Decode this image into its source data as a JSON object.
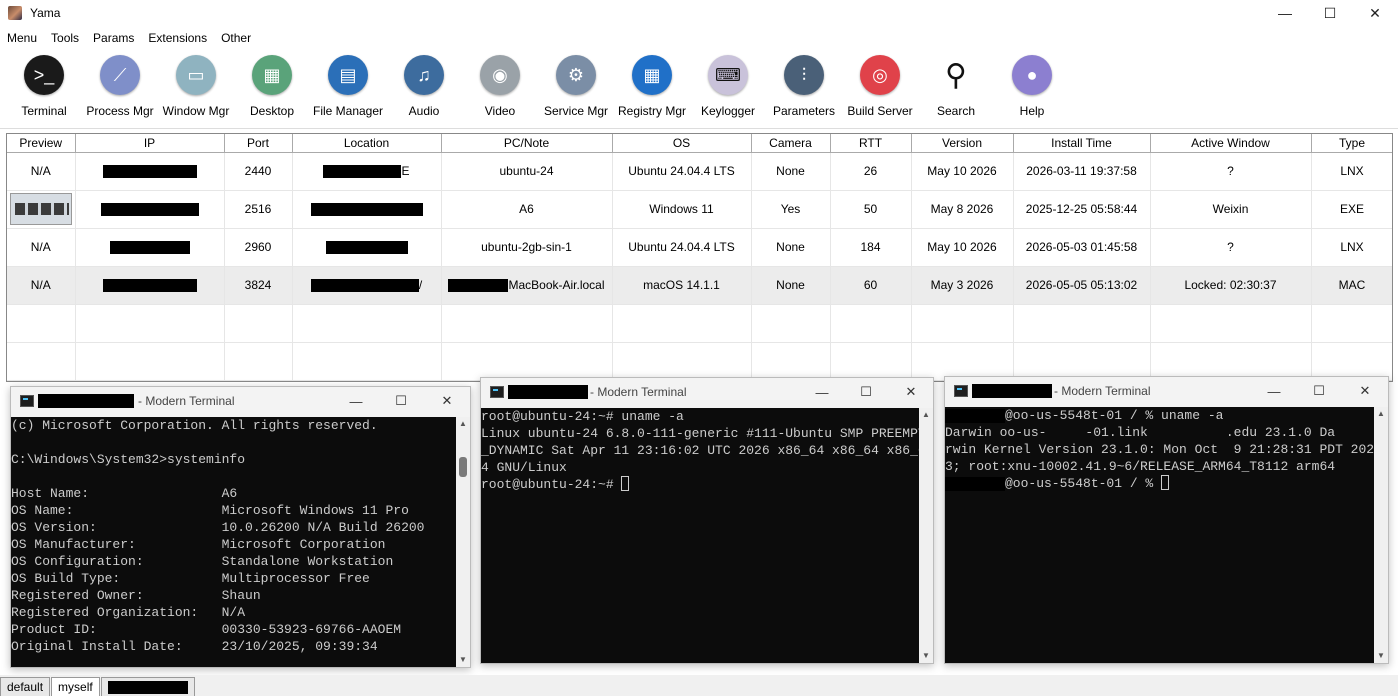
{
  "app": {
    "title": "Yama"
  },
  "menu": [
    "Menu",
    "Tools",
    "Params",
    "Extensions",
    "Other"
  ],
  "toolbar": [
    {
      "label": "Terminal",
      "icon": "terminal-icon",
      "color": "#1a1a1a",
      "glyph": ">_"
    },
    {
      "label": "Process Mgr",
      "icon": "process-graph-icon",
      "color": "#7f8fc9",
      "glyph": "⟋"
    },
    {
      "label": "Window Mgr",
      "icon": "window-icon",
      "color": "#8fb3c0",
      "glyph": "▭"
    },
    {
      "label": "Desktop",
      "icon": "desktop-icon",
      "color": "#5aa37a",
      "glyph": "▦"
    },
    {
      "label": "File Manager",
      "icon": "file-manager-icon",
      "color": "#2b6fb8",
      "glyph": "▤"
    },
    {
      "label": "Audio",
      "icon": "music-note-icon",
      "color": "#3d6c9e",
      "glyph": "♫"
    },
    {
      "label": "Video",
      "icon": "video-camera-icon",
      "color": "#9aa2a8",
      "glyph": "◉"
    },
    {
      "label": "Service Mgr",
      "icon": "gears-icon",
      "color": "#7b8ea6",
      "glyph": "⚙"
    },
    {
      "label": "Registry Mgr",
      "icon": "registry-grid-icon",
      "color": "#2070c8",
      "glyph": "▦"
    },
    {
      "label": "Keylogger",
      "icon": "keyboard-icon",
      "color": "#c9c2da",
      "glyph": "⌨"
    },
    {
      "label": "Parameters",
      "icon": "sliders-icon",
      "color": "#4a6078",
      "glyph": "⫶"
    },
    {
      "label": "Build Server",
      "icon": "target-icon",
      "color": "#e0424a",
      "glyph": "◎"
    },
    {
      "label": "Search",
      "icon": "magnifier-icon",
      "color": "#ffffff",
      "glyph": "⚲"
    },
    {
      "label": "Help",
      "icon": "user-help-icon",
      "color": "#8c7fd0",
      "glyph": "●"
    }
  ],
  "grid": {
    "columns": [
      "Preview",
      "IP",
      "Port",
      "Location",
      "PC/Note",
      "OS",
      "Camera",
      "RTT",
      "Version",
      "Install Time",
      "Active Window",
      "Type"
    ],
    "rows": [
      {
        "preview": "N/A",
        "port": "2440",
        "location_suffix": "E",
        "pc": "ubuntu-24",
        "os": "Ubuntu 24.04.4 LTS",
        "camera": "None",
        "rtt": "26",
        "version": "May 10 2026",
        "install": "2026-03-11 19:37:58",
        "active": "?",
        "type": "LNX"
      },
      {
        "preview": "",
        "port": "2516",
        "location_suffix": "",
        "pc": "A6",
        "os": "Windows 11",
        "camera": "Yes",
        "rtt": "50",
        "version": "May  8 2026",
        "install": "2025-12-25 05:58:44",
        "active": "Weixin",
        "type": "EXE"
      },
      {
        "preview": "N/A",
        "port": "2960",
        "location_suffix": "",
        "pc": "ubuntu-2gb-sin-1",
        "os": "Ubuntu 24.04.4 LTS",
        "camera": "None",
        "rtt": "184",
        "version": "May 10 2026",
        "install": "2026-05-03 01:45:58",
        "active": "?",
        "type": "LNX"
      },
      {
        "preview": "N/A",
        "port": "3824",
        "location_suffix": "/",
        "pc": "MacBook-Air.local",
        "os": "macOS 14.1.1",
        "camera": "None",
        "rtt": "60",
        "version": "May  3 2026",
        "install": "2026-05-05 05:13:02",
        "active": "Locked: 02:30:37",
        "type": "MAC"
      }
    ]
  },
  "terminals": [
    {
      "title": "- Modern Terminal",
      "lines": [
        "(c) Microsoft Corporation. All rights reserved.",
        "",
        "C:\\Windows\\System32>systeminfo",
        "",
        "Host Name:                 A6",
        "OS Name:                   Microsoft Windows 11 Pro",
        "OS Version:                10.0.26200 N/A Build 26200",
        "OS Manufacturer:           Microsoft Corporation",
        "OS Configuration:          Standalone Workstation",
        "OS Build Type:             Multiprocessor Free",
        "Registered Owner:          Shaun",
        "Registered Organization:   N/A",
        "Product ID:                00330-53923-69766-AAOEM",
        "Original Install Date:     23/10/2025, 09:39:34"
      ]
    },
    {
      "title": "- Modern Terminal",
      "lines": [
        "root@ubuntu-24:~# uname -a",
        "Linux ubuntu-24 6.8.0-111-generic #111-Ubuntu SMP PREEMPT",
        "_DYNAMIC Sat Apr 11 23:16:02 UTC 2026 x86_64 x86_64 x86_6",
        "4 GNU/Linux",
        "root@ubuntu-24:~# "
      ]
    },
    {
      "title": "- Modern Terminal",
      "lines": [
        "@oo-us-5548t-01 / % uname -a",
        "Darwin oo-us-     -01.link          .edu 23.1.0 Da",
        "rwin Kernel Version 23.1.0: Mon Oct  9 21:28:31 PDT 202",
        "3; root:xnu-10002.41.9~6/RELEASE_ARM64_T8112 arm64",
        "@oo-us-5548t-01 / % "
      ]
    }
  ],
  "tabs": [
    "default",
    "myself"
  ]
}
